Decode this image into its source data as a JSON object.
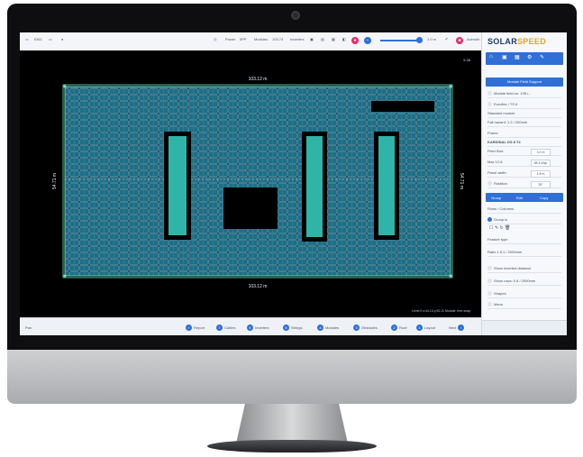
{
  "app": {
    "brand_prefix": "SOLAR",
    "brand_suffix": "SPEED",
    "accent_color": "#2f6fd6",
    "brand_color": "#1f3b66"
  },
  "toolbar": {
    "lang": "ENG",
    "user_icon": "user-icon",
    "help_icon": "help-icon",
    "items": [
      "Power",
      "Modules",
      "Inverters",
      "Azimuth",
      "kWp"
    ],
    "values": [
      "5PP",
      "103.74",
      "1978",
      "180"
    ],
    "zoom_readout": "1.0 m"
  },
  "canvas": {
    "top_dim": "103.12 m",
    "bottom_dim": "103.12 m",
    "left_dim": "54.71 m",
    "right_dim": "54.71 m",
    "overlay_marker": "5.38",
    "status": "Level 0   x:44.14   y:52.11   Module: free snap"
  },
  "bottom": {
    "left_label": "Pan",
    "steps": [
      "Layout",
      "Roof",
      "Obstacles",
      "Modules",
      "Strings",
      "Inverters",
      "Cables",
      "Report"
    ],
    "next_label": "Next"
  },
  "panel": {
    "header_button": "Module Field Support",
    "rows": [
      "Module field no. 1/Sh…",
      "Euroflex / TS 6",
      "Standard module",
      "Fall hazard: 1.2 / 200mm",
      "Frame",
      "KARDINAL DS 8 T4",
      "Field Size",
      "Max 12.8",
      "Panel width",
      "Rotation",
      "Rows / Columns",
      "Group is",
      "Feature type",
      "Ratio 1.5:1 / 2000mm",
      "Show inverted distance",
      "Show rows: 0.8 / 2000mm",
      "Shapes",
      "Menu"
    ],
    "field_values": [
      "3.2 m",
      "58.4 kWp",
      "1.8 m",
      "25°"
    ],
    "tabs": [
      "Group",
      "Edit",
      "Copy"
    ]
  }
}
